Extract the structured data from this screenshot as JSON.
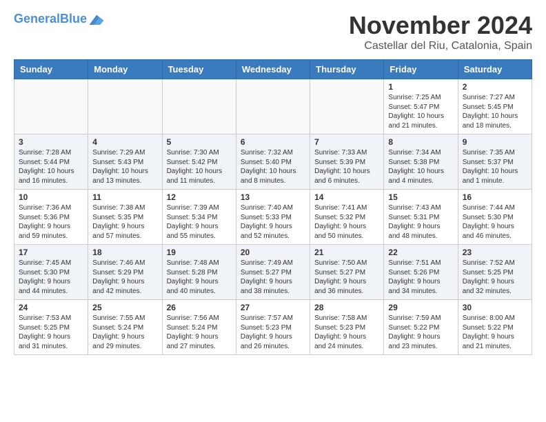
{
  "header": {
    "logo_line1": "General",
    "logo_line2": "Blue",
    "month_title": "November 2024",
    "location": "Castellar del Riu, Catalonia, Spain"
  },
  "weekdays": [
    "Sunday",
    "Monday",
    "Tuesday",
    "Wednesday",
    "Thursday",
    "Friday",
    "Saturday"
  ],
  "weeks": [
    [
      {
        "day": "",
        "sunrise": "",
        "sunset": "",
        "daylight": ""
      },
      {
        "day": "",
        "sunrise": "",
        "sunset": "",
        "daylight": ""
      },
      {
        "day": "",
        "sunrise": "",
        "sunset": "",
        "daylight": ""
      },
      {
        "day": "",
        "sunrise": "",
        "sunset": "",
        "daylight": ""
      },
      {
        "day": "",
        "sunrise": "",
        "sunset": "",
        "daylight": ""
      },
      {
        "day": "1",
        "sunrise": "Sunrise: 7:25 AM",
        "sunset": "Sunset: 5:47 PM",
        "daylight": "Daylight: 10 hours and 21 minutes."
      },
      {
        "day": "2",
        "sunrise": "Sunrise: 7:27 AM",
        "sunset": "Sunset: 5:45 PM",
        "daylight": "Daylight: 10 hours and 18 minutes."
      }
    ],
    [
      {
        "day": "3",
        "sunrise": "Sunrise: 7:28 AM",
        "sunset": "Sunset: 5:44 PM",
        "daylight": "Daylight: 10 hours and 16 minutes."
      },
      {
        "day": "4",
        "sunrise": "Sunrise: 7:29 AM",
        "sunset": "Sunset: 5:43 PM",
        "daylight": "Daylight: 10 hours and 13 minutes."
      },
      {
        "day": "5",
        "sunrise": "Sunrise: 7:30 AM",
        "sunset": "Sunset: 5:42 PM",
        "daylight": "Daylight: 10 hours and 11 minutes."
      },
      {
        "day": "6",
        "sunrise": "Sunrise: 7:32 AM",
        "sunset": "Sunset: 5:40 PM",
        "daylight": "Daylight: 10 hours and 8 minutes."
      },
      {
        "day": "7",
        "sunrise": "Sunrise: 7:33 AM",
        "sunset": "Sunset: 5:39 PM",
        "daylight": "Daylight: 10 hours and 6 minutes."
      },
      {
        "day": "8",
        "sunrise": "Sunrise: 7:34 AM",
        "sunset": "Sunset: 5:38 PM",
        "daylight": "Daylight: 10 hours and 4 minutes."
      },
      {
        "day": "9",
        "sunrise": "Sunrise: 7:35 AM",
        "sunset": "Sunset: 5:37 PM",
        "daylight": "Daylight: 10 hours and 1 minute."
      }
    ],
    [
      {
        "day": "10",
        "sunrise": "Sunrise: 7:36 AM",
        "sunset": "Sunset: 5:36 PM",
        "daylight": "Daylight: 9 hours and 59 minutes."
      },
      {
        "day": "11",
        "sunrise": "Sunrise: 7:38 AM",
        "sunset": "Sunset: 5:35 PM",
        "daylight": "Daylight: 9 hours and 57 minutes."
      },
      {
        "day": "12",
        "sunrise": "Sunrise: 7:39 AM",
        "sunset": "Sunset: 5:34 PM",
        "daylight": "Daylight: 9 hours and 55 minutes."
      },
      {
        "day": "13",
        "sunrise": "Sunrise: 7:40 AM",
        "sunset": "Sunset: 5:33 PM",
        "daylight": "Daylight: 9 hours and 52 minutes."
      },
      {
        "day": "14",
        "sunrise": "Sunrise: 7:41 AM",
        "sunset": "Sunset: 5:32 PM",
        "daylight": "Daylight: 9 hours and 50 minutes."
      },
      {
        "day": "15",
        "sunrise": "Sunrise: 7:43 AM",
        "sunset": "Sunset: 5:31 PM",
        "daylight": "Daylight: 9 hours and 48 minutes."
      },
      {
        "day": "16",
        "sunrise": "Sunrise: 7:44 AM",
        "sunset": "Sunset: 5:30 PM",
        "daylight": "Daylight: 9 hours and 46 minutes."
      }
    ],
    [
      {
        "day": "17",
        "sunrise": "Sunrise: 7:45 AM",
        "sunset": "Sunset: 5:30 PM",
        "daylight": "Daylight: 9 hours and 44 minutes."
      },
      {
        "day": "18",
        "sunrise": "Sunrise: 7:46 AM",
        "sunset": "Sunset: 5:29 PM",
        "daylight": "Daylight: 9 hours and 42 minutes."
      },
      {
        "day": "19",
        "sunrise": "Sunrise: 7:48 AM",
        "sunset": "Sunset: 5:28 PM",
        "daylight": "Daylight: 9 hours and 40 minutes."
      },
      {
        "day": "20",
        "sunrise": "Sunrise: 7:49 AM",
        "sunset": "Sunset: 5:27 PM",
        "daylight": "Daylight: 9 hours and 38 minutes."
      },
      {
        "day": "21",
        "sunrise": "Sunrise: 7:50 AM",
        "sunset": "Sunset: 5:27 PM",
        "daylight": "Daylight: 9 hours and 36 minutes."
      },
      {
        "day": "22",
        "sunrise": "Sunrise: 7:51 AM",
        "sunset": "Sunset: 5:26 PM",
        "daylight": "Daylight: 9 hours and 34 minutes."
      },
      {
        "day": "23",
        "sunrise": "Sunrise: 7:52 AM",
        "sunset": "Sunset: 5:25 PM",
        "daylight": "Daylight: 9 hours and 32 minutes."
      }
    ],
    [
      {
        "day": "24",
        "sunrise": "Sunrise: 7:53 AM",
        "sunset": "Sunset: 5:25 PM",
        "daylight": "Daylight: 9 hours and 31 minutes."
      },
      {
        "day": "25",
        "sunrise": "Sunrise: 7:55 AM",
        "sunset": "Sunset: 5:24 PM",
        "daylight": "Daylight: 9 hours and 29 minutes."
      },
      {
        "day": "26",
        "sunrise": "Sunrise: 7:56 AM",
        "sunset": "Sunset: 5:24 PM",
        "daylight": "Daylight: 9 hours and 27 minutes."
      },
      {
        "day": "27",
        "sunrise": "Sunrise: 7:57 AM",
        "sunset": "Sunset: 5:23 PM",
        "daylight": "Daylight: 9 hours and 26 minutes."
      },
      {
        "day": "28",
        "sunrise": "Sunrise: 7:58 AM",
        "sunset": "Sunset: 5:23 PM",
        "daylight": "Daylight: 9 hours and 24 minutes."
      },
      {
        "day": "29",
        "sunrise": "Sunrise: 7:59 AM",
        "sunset": "Sunset: 5:22 PM",
        "daylight": "Daylight: 9 hours and 23 minutes."
      },
      {
        "day": "30",
        "sunrise": "Sunrise: 8:00 AM",
        "sunset": "Sunset: 5:22 PM",
        "daylight": "Daylight: 9 hours and 21 minutes."
      }
    ]
  ]
}
